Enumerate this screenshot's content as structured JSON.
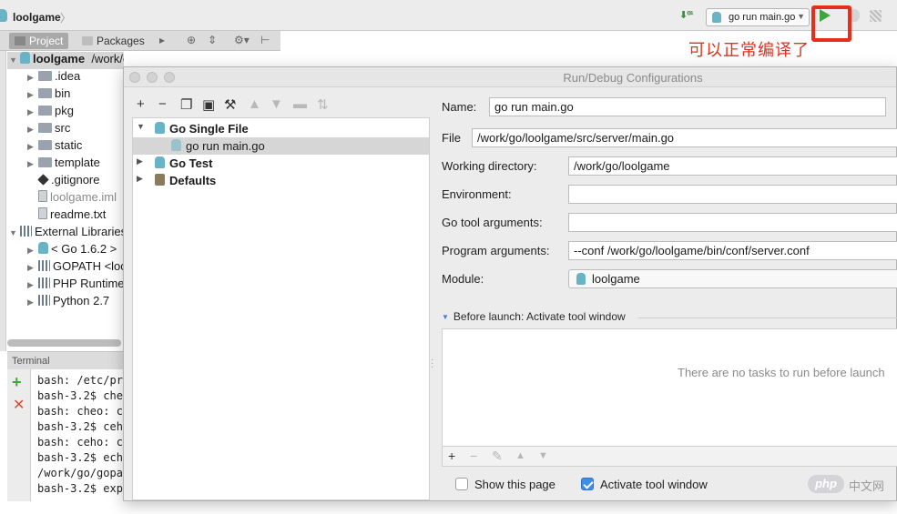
{
  "topbar": {
    "project_name": "loolgame",
    "run_config": "go run main.go",
    "annotation": "可以正常编译了",
    "colors": {
      "run": "#3fa63f",
      "highlight": "#e62e1c"
    }
  },
  "project_panel": {
    "tabs": [
      "Project",
      "Packages"
    ],
    "root": {
      "name": "loolgame",
      "path": "/work/go/loolgame"
    },
    "items": [
      {
        "label": ".idea",
        "type": "folder"
      },
      {
        "label": "bin",
        "type": "folder"
      },
      {
        "label": "pkg",
        "type": "folder"
      },
      {
        "label": "src",
        "type": "folder"
      },
      {
        "label": "static",
        "type": "folder"
      },
      {
        "label": "template",
        "type": "folder"
      },
      {
        "label": ".gitignore",
        "type": "git"
      },
      {
        "label": "loolgame.iml",
        "type": "file-muted"
      },
      {
        "label": "readme.txt",
        "type": "file"
      },
      {
        "label": "External Libraries",
        "type": "lib"
      },
      {
        "label": "< Go 1.6.2 >",
        "type": "go"
      },
      {
        "label": "GOPATH <loolgame>",
        "type": "lib"
      },
      {
        "label": "PHP Runtime",
        "type": "lib"
      },
      {
        "label": "Python 2.7",
        "type": "lib"
      }
    ]
  },
  "terminal": {
    "title": "Terminal",
    "lines": [
      "bash: /etc/pr",
      "bash-3.2$ che",
      "bash: cheo: c",
      "bash-3.2$ ceh",
      "bash: ceho: c",
      "bash-3.2$ ech",
      "/work/go/gopa",
      "bash-3.2$ exp"
    ]
  },
  "dialog": {
    "title": "Run/Debug Configurations",
    "tree": {
      "groups": [
        {
          "label": "Go Single File",
          "expanded": true,
          "children": [
            "go run main.go"
          ]
        },
        {
          "label": "Go Test",
          "expanded": false
        },
        {
          "label": "Defaults",
          "expanded": false
        }
      ]
    },
    "form": {
      "name_label": "Name:",
      "name_value": "go run main.go",
      "file_label": "File",
      "file_value": "/work/go/loolgame/src/server/main.go",
      "workdir_label": "Working directory:",
      "workdir_value": "/work/go/loolgame",
      "env_label": "Environment:",
      "env_value": "",
      "gotool_label": "Go tool arguments:",
      "gotool_value": "",
      "progargs_label": "Program arguments:",
      "progargs_value": "--conf /work/go/loolgame/bin/conf/server.conf",
      "module_label": "Module:",
      "module_value": "loolgame"
    },
    "before_launch": {
      "title": "Before launch: Activate tool window",
      "empty_text": "There are no tasks to run before launch"
    },
    "options": {
      "show_page_label": "Show this page",
      "show_page_checked": false,
      "activate_label": "Activate tool window",
      "activate_checked": true
    }
  },
  "watermark": {
    "logo": "php",
    "text": "中文网"
  }
}
